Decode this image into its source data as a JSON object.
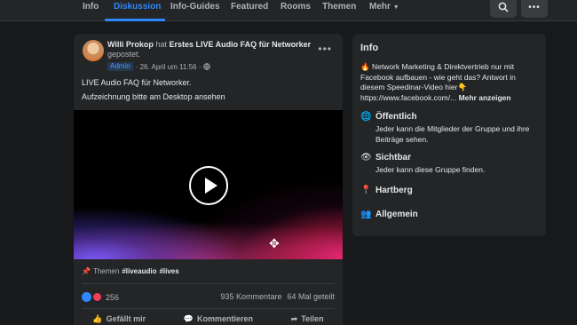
{
  "nav": {
    "tabs": [
      {
        "label": "Info"
      },
      {
        "label": "Diskussion"
      },
      {
        "label": "Info-Guides"
      },
      {
        "label": "Featured"
      },
      {
        "label": "Rooms"
      },
      {
        "label": "Themen"
      },
      {
        "label": "Mehr"
      }
    ],
    "active_tab": "Diskussion",
    "search_icon": "search-icon",
    "more_icon": "more-dots-icon"
  },
  "post": {
    "author": "Willi Prokop",
    "verb": "hat",
    "title": "Erstes LIVE Audio FAQ für Networker",
    "suffix": "gepostet.",
    "badge": "Admin",
    "date": "· 26. April um 11:56 ·",
    "line1": "LIVE Audio FAQ für Networker.",
    "line2": "Aufzeichnung bitte am Desktop ansehen",
    "topics_label": "Themen",
    "tags": [
      "#liveaudio",
      "#lives"
    ],
    "reaction_count": "256",
    "comments": "935 Kommentare",
    "shares": "64 Mal geteilt",
    "actions": {
      "like": "Gefällt mir",
      "comment": "Kommentieren",
      "share": "Teilen"
    }
  },
  "info": {
    "title": "Info",
    "desc_main": "Network Marketing & Direktvertrieb nur mit Facebook aufbauen - wie geht das? Antwort in diesem Speedinar-Video hier",
    "desc_url": "https://www.facebook.com/...",
    "desc_more": "Mehr anzeigen",
    "public_title": "Öffentlich",
    "public_desc": "Jeder kann die Mitglieder der Gruppe und ihre Beiträge sehen.",
    "visible_title": "Sichtbar",
    "visible_desc": "Jeder kann diese Gruppe finden.",
    "location": "Hartberg",
    "category": "Allgemein"
  },
  "colors": {
    "accent": "#2d88ff",
    "background": "#18191a",
    "card": "#242526"
  }
}
